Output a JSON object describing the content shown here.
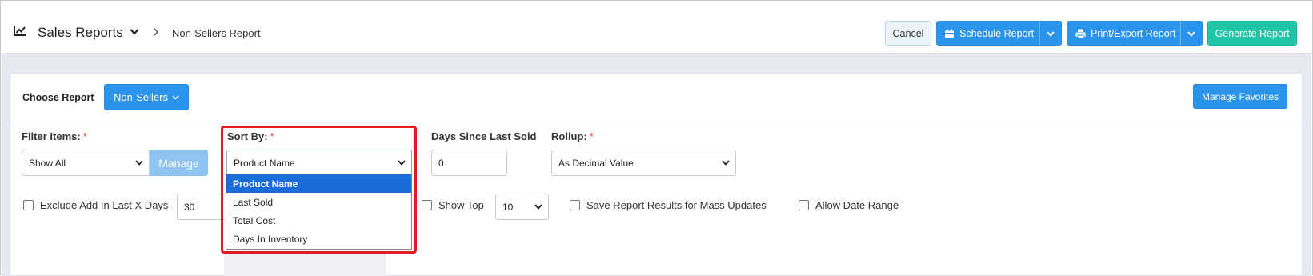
{
  "header": {
    "app_title": "Sales Reports",
    "breadcrumb_current": "Non-Sellers Report",
    "cancel_label": "Cancel",
    "schedule_label": "Schedule Report",
    "print_label": "Print/Export Report",
    "generate_label": "Generate Report"
  },
  "panel": {
    "choose_report_label": "Choose Report",
    "report_selector_label": "Non-Sellers",
    "manage_favorites_label": "Manage Favorites"
  },
  "filters": {
    "filter_items": {
      "label": "Filter Items:",
      "required": "*",
      "value": "Show All",
      "manage_label": "Manage"
    },
    "sort_by": {
      "label": "Sort By:",
      "required": "*",
      "value": "Product Name",
      "options": [
        "Product Name",
        "Last Sold",
        "Total Cost",
        "Days In Inventory"
      ],
      "selected_option": "Product Name"
    },
    "days_since_last_sold": {
      "label": "Days Since Last Sold",
      "value": "0"
    },
    "rollup": {
      "label": "Rollup:",
      "required": "*",
      "value": "As Decimal Value"
    }
  },
  "options": {
    "exclude_add": {
      "label": "Exclude Add In Last X Days",
      "value": "30",
      "checked": false
    },
    "show_top": {
      "label": "Show Top",
      "value": "10",
      "checked": false
    },
    "save_results": {
      "label": "Save Report Results for Mass Updates",
      "checked": false
    },
    "allow_date_range": {
      "label": "Allow Date Range",
      "checked": false
    }
  },
  "colors": {
    "primary": "#2a93eb",
    "teal": "#1ec5a6",
    "highlight": "#e31b23",
    "selected_option": "#1a6ad8"
  }
}
